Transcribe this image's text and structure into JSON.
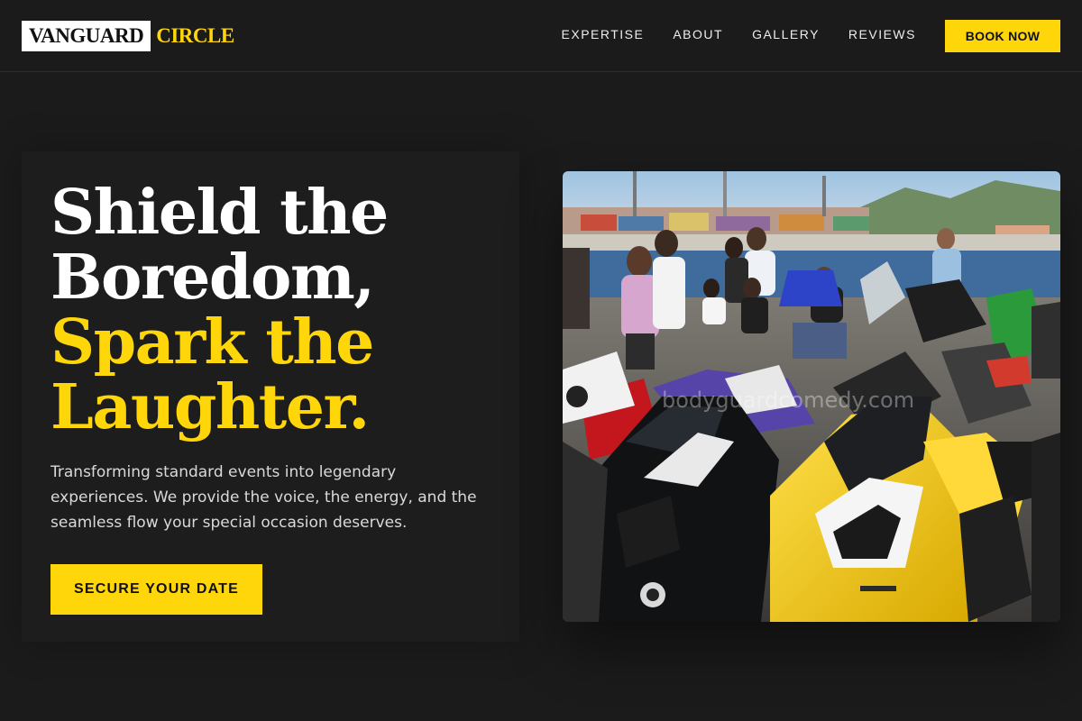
{
  "header": {
    "logo_primary": "VANGUARD",
    "logo_accent": "CIRCLE",
    "nav": [
      "EXPERTISE",
      "ABOUT",
      "GALLERY",
      "REVIEWS"
    ],
    "book_label": "BOOK NOW"
  },
  "hero": {
    "headline_white_1": "Shield the",
    "headline_white_2": "Boredom,",
    "headline_yellow_1": "Spark the",
    "headline_yellow_2": "Laughter.",
    "subtext": "Transforming standard events into legendary experiences. We provide the voice, the energy, and the seamless flow your special occasion deserves.",
    "cta_label": "SECURE YOUR DATE"
  },
  "photo": {
    "watermark": "bodyguardcomedy.com"
  },
  "colors": {
    "accent": "#ffd60a",
    "background": "#1b1b1b"
  }
}
